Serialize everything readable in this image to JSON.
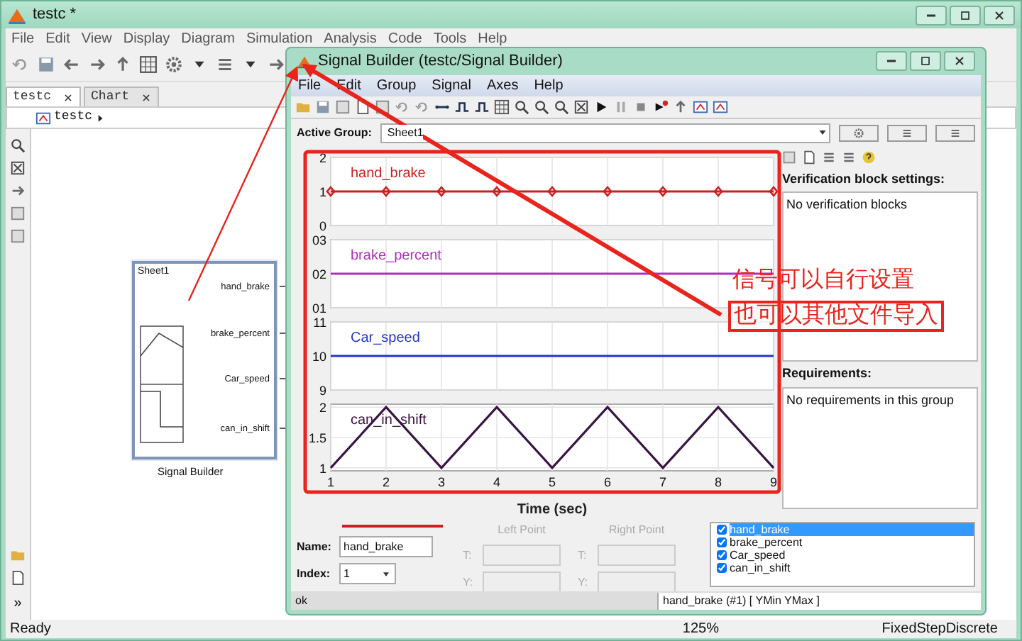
{
  "main_window": {
    "title": "testc *",
    "menu": [
      "File",
      "Edit",
      "View",
      "Display",
      "Diagram",
      "Simulation",
      "Analysis",
      "Code",
      "Tools",
      "Help"
    ],
    "tabs": [
      {
        "label": "testc",
        "selected": true
      },
      {
        "label": "Chart",
        "selected": false
      }
    ],
    "breadcrumb": "testc",
    "more_glyph": "»",
    "block": {
      "title": "Sheet1",
      "ports": [
        "hand_brake",
        "brake_percent",
        "Car_speed",
        "can_in_shift"
      ],
      "caption": "Signal Builder"
    },
    "status_bar": {
      "text": "Ready",
      "zoom": "125%",
      "solver": "FixedStepDiscrete"
    }
  },
  "signal_builder": {
    "title": "Signal Builder (testc/Signal Builder)",
    "menu": [
      "File",
      "Edit",
      "Group",
      "Signal",
      "Axes",
      "Help"
    ],
    "active_group_label": "Active Group:",
    "active_group": "Sheet1",
    "axes": [
      {
        "chart_data": {
          "type": "line",
          "grid": true,
          "x": [
            1,
            2,
            3,
            4,
            5,
            6,
            7,
            8,
            9
          ],
          "xlim": [
            1,
            9
          ],
          "ylim": [
            0,
            2
          ],
          "yticks": [
            0,
            1,
            2
          ],
          "series": [
            {
              "name": "hand_brake",
              "color": "#cc1f1f",
              "marker": "diamond",
              "values": [
                1,
                1,
                1,
                1,
                1,
                1,
                1,
                1,
                1
              ]
            }
          ]
        }
      },
      {
        "chart_data": {
          "type": "line",
          "grid": true,
          "x": [
            1,
            2,
            3,
            4,
            5,
            6,
            7,
            8,
            9
          ],
          "xlim": [
            1,
            9
          ],
          "ylim": [
            1,
            3
          ],
          "yticks": [
            {
              "value": 1,
              "label": "01"
            },
            {
              "value": 2,
              "label": "02"
            },
            {
              "value": 3,
              "label": "03"
            }
          ],
          "series": [
            {
              "name": "brake_percent",
              "color": "#b02cc0",
              "values": [
                2,
                2,
                2,
                2,
                2,
                2,
                2,
                2,
                2
              ]
            }
          ]
        }
      },
      {
        "chart_data": {
          "type": "line",
          "grid": true,
          "x": [
            1,
            2,
            3,
            4,
            5,
            6,
            7,
            8,
            9
          ],
          "xlim": [
            1,
            9
          ],
          "ylim": [
            9,
            11
          ],
          "yticks": [
            9,
            10,
            11
          ],
          "series": [
            {
              "name": "Car_speed",
              "color": "#2234d0",
              "values": [
                10,
                10,
                10,
                10,
                10,
                10,
                10,
                10,
                10
              ]
            }
          ]
        }
      },
      {
        "chart_data": {
          "type": "line",
          "grid": true,
          "xlabel": "Time (sec)",
          "x": [
            1,
            2,
            3,
            4,
            5,
            6,
            7,
            8,
            9
          ],
          "xlim": [
            1,
            9
          ],
          "ylim": [
            0.95,
            2.05
          ],
          "xticks": [
            1,
            2,
            3,
            4,
            5,
            6,
            7,
            8,
            9
          ],
          "yticks": [
            1,
            1.5,
            2
          ],
          "series": [
            {
              "name": "can_in_shift",
              "color": "#3a1444",
              "values": [
                1,
                2,
                1,
                2,
                1,
                2,
                1,
                2,
                1
              ]
            }
          ]
        }
      }
    ],
    "verification": {
      "heading": "Verification block settings:",
      "text": "No verification blocks"
    },
    "requirements": {
      "heading": "Requirements:",
      "text": "No requirements in this group"
    },
    "editor": {
      "name_label": "Name:",
      "name_value": "hand_brake",
      "index_label": "Index:",
      "index_value": "1",
      "points": [
        {
          "label": "Left Point",
          "disabled": true,
          "t_label": "T:",
          "y_label": "Y:"
        },
        {
          "label": "Right Point",
          "disabled": true,
          "t_label": "T:",
          "y_label": "Y:"
        }
      ]
    },
    "signal_list": [
      {
        "label": "hand_brake",
        "checked": true,
        "selected": true
      },
      {
        "label": "brake_percent",
        "checked": true,
        "selected": false
      },
      {
        "label": "Car_speed",
        "checked": true,
        "selected": false
      },
      {
        "label": "can_in_shift",
        "checked": true,
        "selected": false
      }
    ],
    "status_text": "ok",
    "status_info": "hand_brake (#1) [ YMin YMax ]"
  },
  "annotations": {
    "lines": [
      "信号可以自行设置",
      "也可以其他文件导入"
    ]
  }
}
